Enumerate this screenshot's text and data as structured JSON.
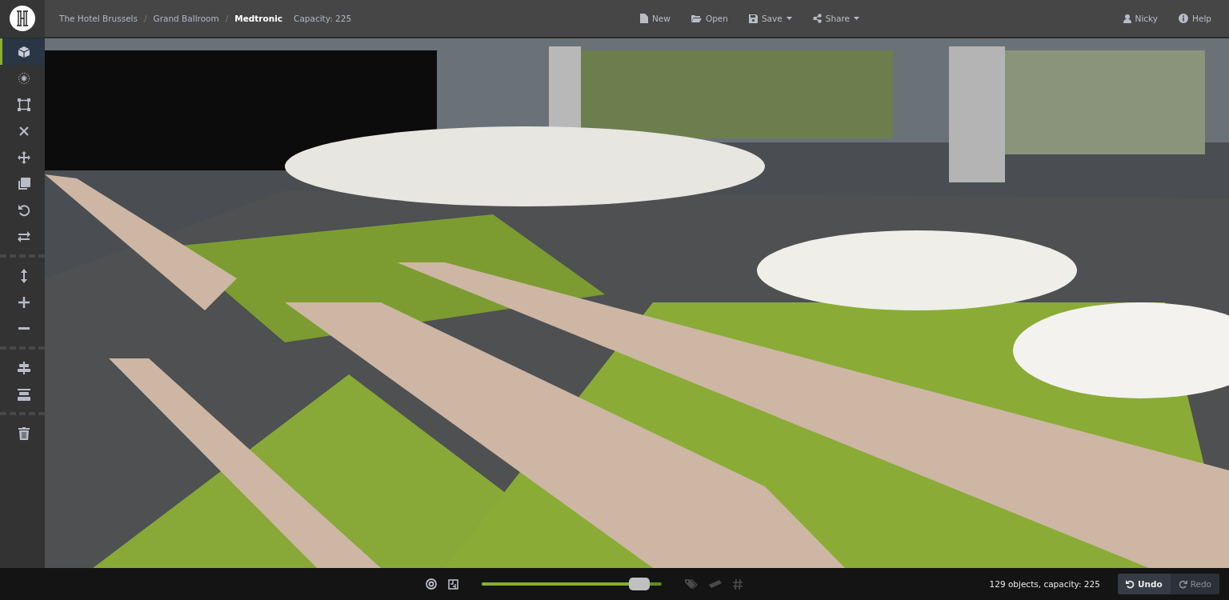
{
  "topbar": {
    "breadcrumb": [
      {
        "label": "The Hotel Brussels",
        "current": false
      },
      {
        "label": "Grand Ballroom",
        "current": false
      },
      {
        "label": "Medtronic",
        "current": true
      }
    ],
    "separator": "/",
    "capacity": "Capacity: 225",
    "menu": [
      {
        "kind": "new",
        "label": "New",
        "dropdown": false
      },
      {
        "kind": "open",
        "label": "Open",
        "dropdown": false
      },
      {
        "kind": "save",
        "label": "Save",
        "dropdown": true
      },
      {
        "kind": "share",
        "label": "Share",
        "dropdown": true
      }
    ],
    "user_menu": [
      {
        "kind": "user",
        "label": "Nicky"
      },
      {
        "kind": "help",
        "label": "Help"
      }
    ]
  },
  "toolbar": {
    "groups": [
      [
        {
          "kind": "cube",
          "selected": true
        },
        {
          "kind": "sparkle",
          "selected": false
        },
        {
          "kind": "select",
          "selected": false
        },
        {
          "kind": "close",
          "selected": false
        },
        {
          "kind": "move",
          "selected": false
        },
        {
          "kind": "copy",
          "selected": false
        },
        {
          "kind": "rotate",
          "selected": false
        },
        {
          "kind": "swap",
          "selected": false
        }
      ],
      [
        {
          "kind": "height",
          "selected": false
        },
        {
          "kind": "plus",
          "selected": false
        },
        {
          "kind": "minus",
          "selected": false
        }
      ],
      [
        {
          "kind": "align",
          "selected": false
        },
        {
          "kind": "distribute",
          "selected": false
        }
      ],
      [
        {
          "kind": "trash",
          "selected": false
        }
      ]
    ]
  },
  "bottombar": {
    "toggles_left": [
      {
        "kind": "target",
        "on": true
      },
      {
        "kind": "floorplan",
        "on": true
      }
    ],
    "zoom_slider": {
      "level": 0.875
    },
    "toggles_right": [
      {
        "kind": "tag",
        "on": false
      },
      {
        "kind": "ruler",
        "on": false
      },
      {
        "kind": "hash",
        "on": false
      }
    ],
    "status": "129 objects, capacity: 225",
    "actions": [
      {
        "kind": "undo",
        "label": "Undo",
        "disabled": false
      },
      {
        "kind": "redo",
        "label": "Redo",
        "disabled": true
      }
    ]
  }
}
